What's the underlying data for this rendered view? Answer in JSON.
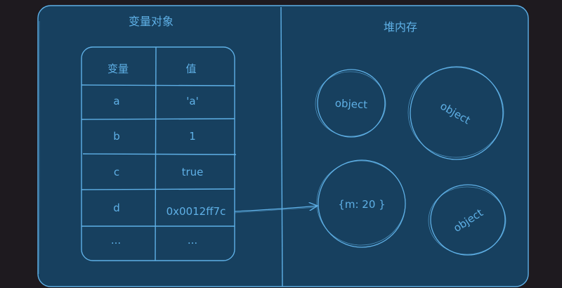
{
  "panels": {
    "left_title": "变量对象",
    "right_title": "堆内存"
  },
  "table": {
    "headers": [
      "变量",
      "值"
    ],
    "rows": [
      [
        "a",
        "'a'"
      ],
      [
        "b",
        "1"
      ],
      [
        "c",
        "true"
      ],
      [
        "d",
        "0x0012ff7c"
      ],
      [
        "...",
        "..."
      ]
    ]
  },
  "heap_objects": [
    "object",
    "object",
    "{m: 20 }",
    "object"
  ],
  "colors": {
    "background": "#1e1a1f",
    "panel_fill": "#17405f",
    "stroke": "#5fb0e6",
    "text": "#5fb0e6"
  }
}
